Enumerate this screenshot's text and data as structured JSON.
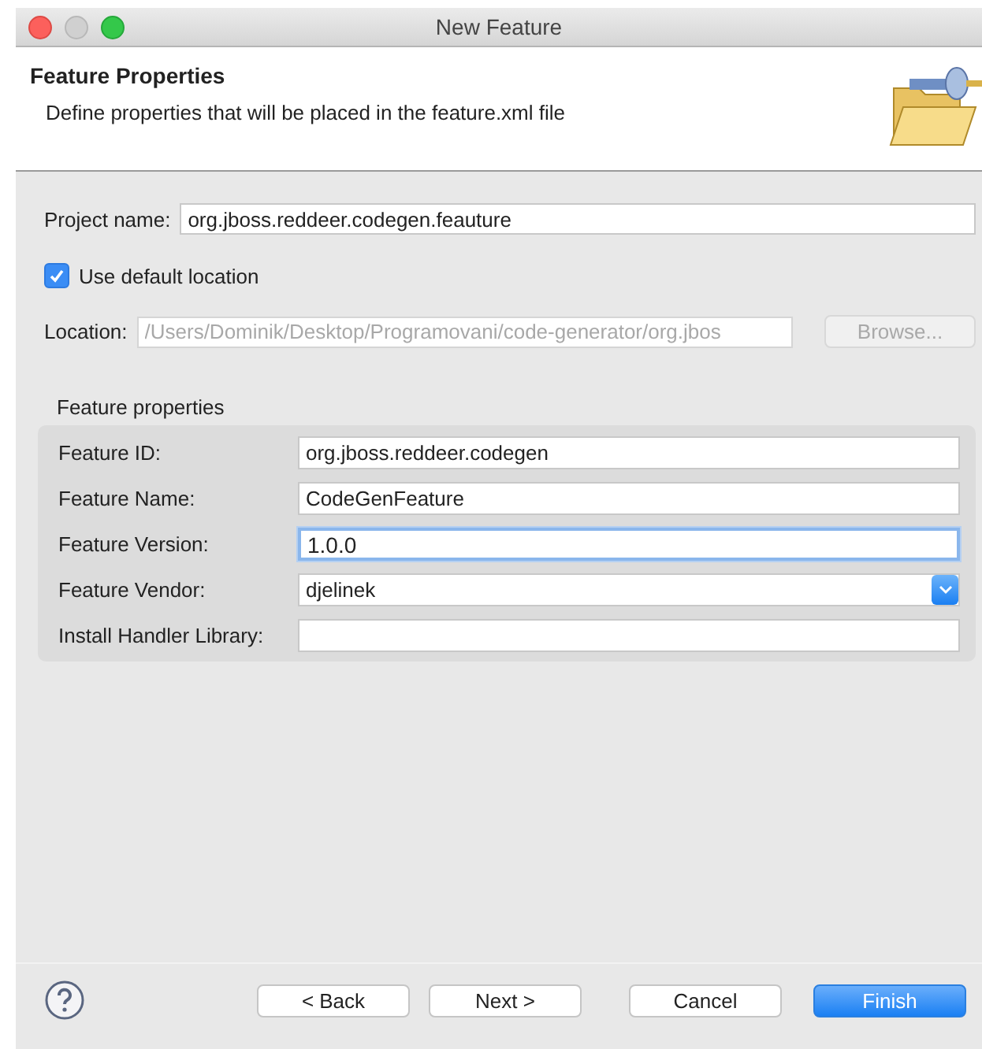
{
  "window": {
    "title": "New Feature"
  },
  "header": {
    "title": "Feature Properties",
    "description": "Define properties that will be placed in the feature.xml file"
  },
  "project_name": {
    "label": "Project name:",
    "value": "org.jboss.reddeer.codegen.feauture"
  },
  "use_default_location": {
    "label": "Use default location",
    "checked": true
  },
  "location": {
    "label": "Location:",
    "value": "/Users/Dominik/Desktop/Programovani/code-generator/org.jbos",
    "disabled": true,
    "browse": "Browse..."
  },
  "feature_properties": {
    "title": "Feature properties",
    "fields": [
      {
        "label": "Feature ID:",
        "value": "org.jboss.reddeer.codegen",
        "kind": "text",
        "focused": false
      },
      {
        "label": "Feature Name:",
        "value": "CodeGenFeature",
        "kind": "text",
        "focused": false
      },
      {
        "label": "Feature Version:",
        "value": "1.0.0",
        "kind": "text",
        "focused": true
      },
      {
        "label": "Feature Vendor:",
        "value": "djelinek",
        "kind": "combo",
        "focused": false
      },
      {
        "label": "Install Handler Library:",
        "kind": "text",
        "focused": false
      }
    ]
  },
  "buttons": [
    {
      "label": "< Back",
      "default": false
    },
    {
      "label": "Next >",
      "default": false
    },
    {
      "label": "Cancel",
      "default": false
    },
    {
      "label": "Finish",
      "default": true
    }
  ]
}
